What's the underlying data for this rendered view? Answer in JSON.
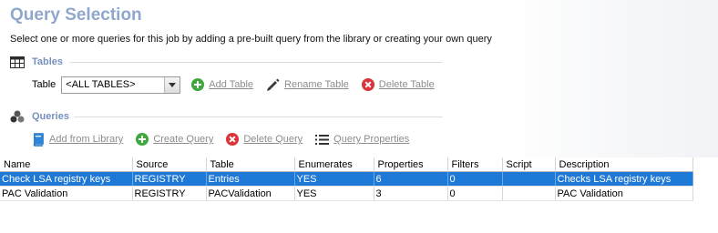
{
  "header": {
    "title": "Query Selection",
    "subtitle": "Select one or more queries for this job by adding a pre-built query from the library or creating your own query"
  },
  "tables_section": {
    "label": "Tables",
    "table_label": "Table",
    "selected_table": "<ALL TABLES>",
    "add_label": "Add Table",
    "rename_label": "Rename Table",
    "delete_label": "Delete Table"
  },
  "queries_section": {
    "label": "Queries",
    "add_from_library_label": "Add from Library",
    "create_label": "Create Query",
    "delete_label": "Delete Query",
    "properties_label": "Query Properties"
  },
  "grid": {
    "columns": [
      "Name",
      "Source",
      "Table",
      "Enumerates",
      "Properties",
      "Filters",
      "Script",
      "Description"
    ],
    "rows": [
      [
        "Check LSA registry keys",
        "REGISTRY",
        "Entries",
        "YES",
        "6",
        "0",
        "",
        "Checks LSA registry keys"
      ],
      [
        "PAC Validation",
        "REGISTRY",
        "PACValidation",
        "YES",
        "3",
        "0",
        "",
        "PAC Validation"
      ]
    ],
    "selected_row": 0
  },
  "colors": {
    "title": "#8fa7cc",
    "section_label": "#7690bd",
    "selection": "#1e78d6",
    "add_green": "#3da83d",
    "delete_red": "#d9343a"
  }
}
